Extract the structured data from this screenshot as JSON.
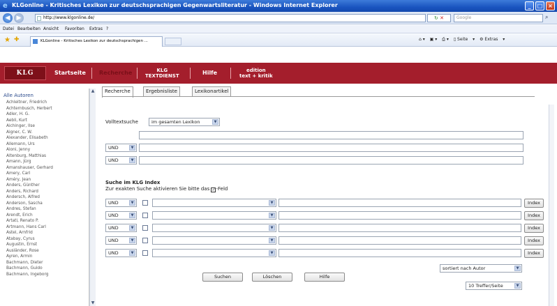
{
  "browser": {
    "title": "KLGonline - Kritisches Lexikon zur deutschsprachigen Gegenwartsliteratur - Windows Internet Explorer",
    "address": "http://www.klgonline.de/",
    "search_placeholder": "Google",
    "menu": [
      "Datei",
      "Bearbeiten",
      "Ansicht",
      "Favoriten",
      "Extras",
      "?"
    ],
    "tab_title": "KLGonline - Kritisches Lexikon zur deutschsprachigen ...",
    "cmd_page": "Seite",
    "cmd_extras": "Extras"
  },
  "site": {
    "logo": "KLG",
    "nav": {
      "startseite": "Startseite",
      "recherche": "Recherche",
      "textdienst_top": "KLG",
      "textdienst_bottom": "TEXTDIENST",
      "hilfe": "Hilfe",
      "edition_top": "edition",
      "edition_bottom": "text + kritik"
    }
  },
  "sidebar": {
    "all_authors": "Alle Autoren",
    "authors": [
      "Achleitner, Friedrich",
      "Achternbusch, Herbert",
      "Adler, H. G.",
      "Aebli, Kurt",
      "Aichinger, Ilse",
      "Aigner, C. W.",
      "Alexander, Elisabeth",
      "Allemann, Urs",
      "Aloni, Jenny",
      "Altenburg, Matthias",
      "Amann, Jürg",
      "Amanshauser, Gerhard",
      "Amery, Carl",
      "Améry, Jean",
      "Anders, Günther",
      "Anders, Richard",
      "Andersch, Alfred",
      "Anderson, Sascha",
      "Andres, Stefan",
      "Arendt, Erich",
      "Artati, Renato P.",
      "Artmann, Hans Carl",
      "Astel, Arnfrid",
      "Atabay, Cyrus",
      "Augustin, Ernst",
      "Ausländer, Rose",
      "Ayren, Armin",
      "Bachmann, Dieter",
      "Bachmann, Guido",
      "Bachmann, Ingeborg"
    ]
  },
  "content": {
    "tabs": [
      "Recherche",
      "Ergebnisliste",
      "Lexikonartikel"
    ],
    "volltext_label": "Volltextsuche",
    "volltext_scope": "im gesamten Lexikon",
    "operator": "UND",
    "index_heading": "Suche im KLG Index",
    "index_hint_pre": "Zur exakten Suche aktivieren Sie bitte das",
    "index_hint_post": "-Feld",
    "index_button": "Index",
    "sort": "sortiert nach Autor",
    "per_page": "10 Treffer/Seite",
    "buttons": {
      "search": "Suchen",
      "clear": "Löschen",
      "help": "Hilfe"
    }
  }
}
